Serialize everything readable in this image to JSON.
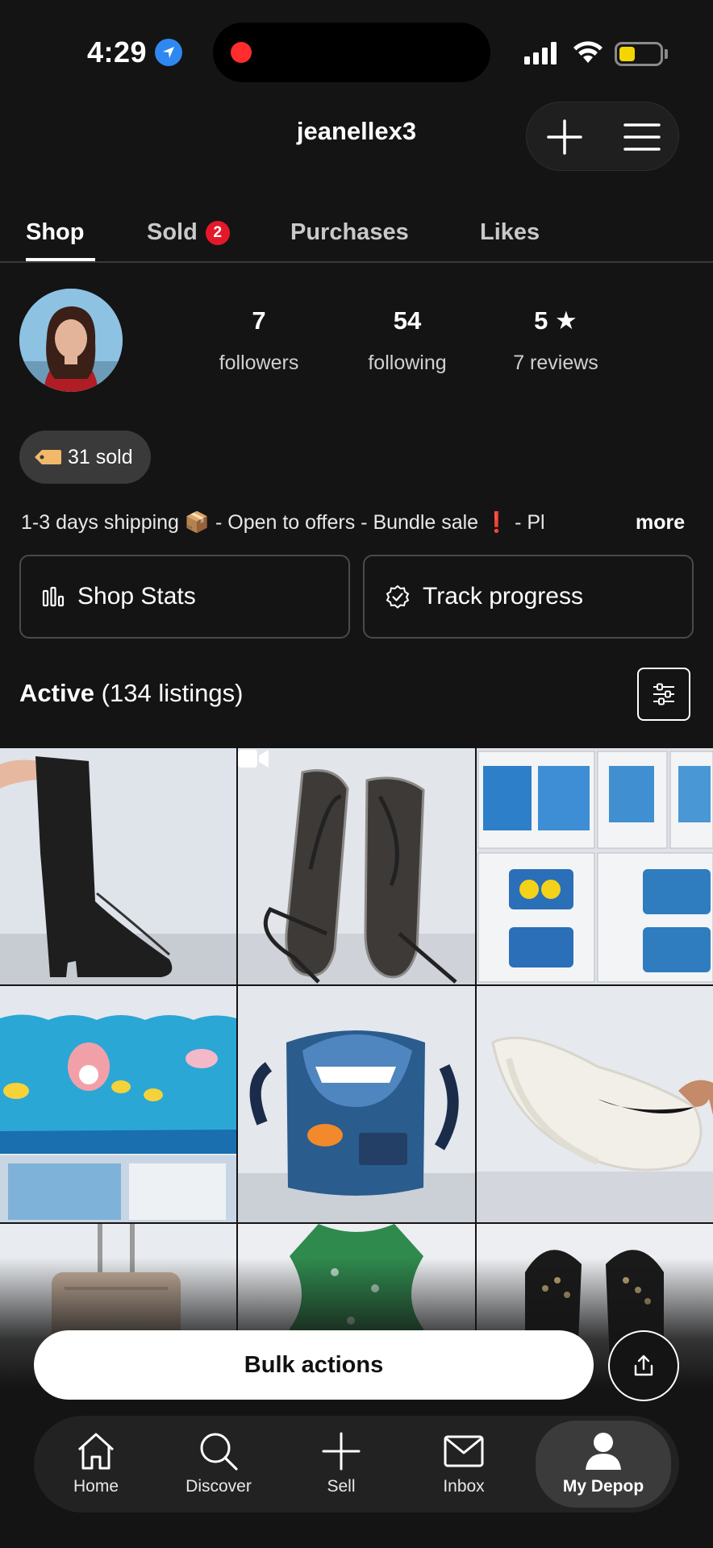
{
  "status_bar": {
    "time": "4:29",
    "battery_level": 0.35,
    "battery_color": "#f5d500",
    "recording_indicator_color": "#ff2d2d",
    "location_icon": "location-arrow-icon"
  },
  "header": {
    "username": "jeanellex3",
    "add_icon": "plus-icon",
    "menu_icon": "hamburger-menu-icon"
  },
  "tabs": [
    {
      "label": "Shop",
      "active": true
    },
    {
      "label": "Sold",
      "badge": "2"
    },
    {
      "label": "Purchases"
    },
    {
      "label": "Likes"
    }
  ],
  "profile": {
    "stats": [
      {
        "value": "7",
        "label": "followers"
      },
      {
        "value": "54",
        "label": "following"
      },
      {
        "value": "5 ★",
        "label": "7 reviews"
      }
    ],
    "sold_pill": "31 sold",
    "bio": "1-3 days shipping 📦 - Open to offers - Bundle sale ❗ - Pl",
    "more_label": "more"
  },
  "actions": {
    "shop_stats": "Shop Stats",
    "track_progress": "Track progress"
  },
  "listings": {
    "active_label": "Active",
    "count_label": "(134 listings)",
    "items": [
      {
        "name": "listing-black-boots",
        "icon": "boots"
      },
      {
        "name": "listing-silver-sandals",
        "icon": "sandals",
        "video": true
      },
      {
        "name": "listing-minions-bedding-set",
        "icon": "bedding"
      },
      {
        "name": "listing-spongebob-curtain",
        "icon": "curtain"
      },
      {
        "name": "listing-nemo-backpack",
        "icon": "backpack"
      },
      {
        "name": "listing-white-sneakers",
        "icon": "sneaker"
      },
      {
        "name": "listing-luggage",
        "icon": "luggage"
      },
      {
        "name": "listing-green-floral-top",
        "icon": "top"
      },
      {
        "name": "listing-studded-sandals",
        "icon": "studded-sandals"
      }
    ]
  },
  "bulk_actions_label": "Bulk actions",
  "nav": [
    {
      "label": "Home",
      "icon": "home-icon"
    },
    {
      "label": "Discover",
      "icon": "search-icon"
    },
    {
      "label": "Sell",
      "icon": "plus-icon"
    },
    {
      "label": "Inbox",
      "icon": "mail-icon"
    },
    {
      "label": "My Depop",
      "icon": "person-icon",
      "active": true
    }
  ]
}
